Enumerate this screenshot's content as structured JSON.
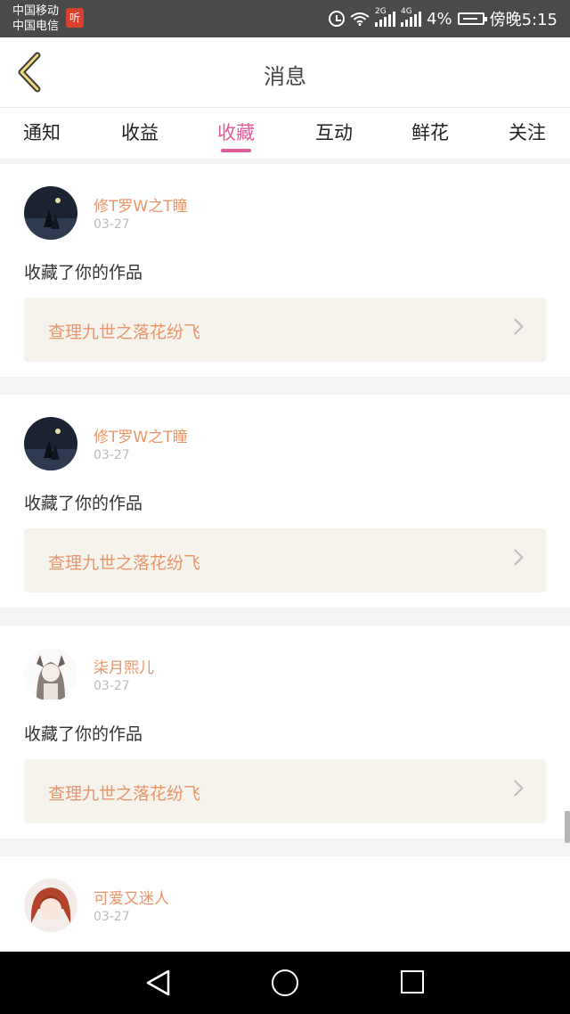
{
  "status_bar": {
    "carrier1": "中国移动",
    "carrier2": "中国电信",
    "app_badge": "听",
    "net_tag1": "2G",
    "net_tag2": "4G",
    "battery": "4%",
    "time": "傍晚5:15"
  },
  "header": {
    "title": "消息"
  },
  "tabs": [
    {
      "label": "通知"
    },
    {
      "label": "收益"
    },
    {
      "label": "收藏"
    },
    {
      "label": "互动"
    },
    {
      "label": "鲜花"
    },
    {
      "label": "关注"
    }
  ],
  "active_tab": "收藏",
  "colors": {
    "accent": "#e25c9a",
    "name": "#e8956a",
    "work_bg": "#f5f3ec"
  },
  "messages": [
    {
      "user": "修T罗W之T瞳",
      "date": "03-27",
      "action": "收藏了你的作品",
      "work": "查理九世之落花纷飞",
      "avatar": "dark-night-scene-avatar"
    },
    {
      "user": "修T罗W之T瞳",
      "date": "03-27",
      "action": "收藏了你的作品",
      "work": "查理九世之落花纷飞",
      "avatar": "dark-night-scene-avatar"
    },
    {
      "user": "柒月熙儿",
      "date": "03-27",
      "action": "收藏了你的作品",
      "work": "查理九世之落花纷飞",
      "avatar": "anime-girl-sketch-avatar"
    },
    {
      "user": "可爱又迷人",
      "date": "03-27",
      "action": "",
      "work": "",
      "avatar": "anime-redhair-avatar"
    }
  ]
}
